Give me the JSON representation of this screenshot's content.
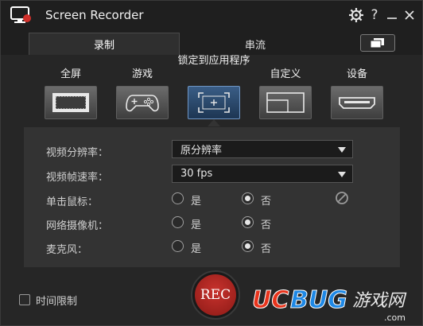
{
  "app": {
    "title": "Screen Recorder"
  },
  "tabs": [
    {
      "label": "录制"
    },
    {
      "label": "串流"
    }
  ],
  "modes": [
    {
      "label": "全屏",
      "icon": "fullscreen-icon"
    },
    {
      "label": "游戏",
      "icon": "gamepad-icon"
    },
    {
      "label": "锁定到应用程序",
      "icon": "lock-app-icon"
    },
    {
      "label": "自定义",
      "icon": "custom-area-icon"
    },
    {
      "label": "设备",
      "icon": "hdmi-device-icon"
    }
  ],
  "settings": {
    "resolution": {
      "label": "视频分辨率：",
      "value": "原分辨率"
    },
    "framerate": {
      "label": "视频帧速率：",
      "value": "30 fps"
    },
    "yes_label": "是",
    "no_label": "否",
    "mouse_click": {
      "label": "单击鼠标：",
      "selected": "否"
    },
    "webcam": {
      "label": "网络摄像机：",
      "selected": "否"
    },
    "microphone": {
      "label": "麦克风：",
      "selected": "否"
    }
  },
  "footer": {
    "time_limit_label": "时间限制",
    "time_limit_checked": false,
    "rec_label": "REC"
  },
  "watermark": {
    "brand": "UCBUG",
    "suffix": "游戏网",
    "domain": ".com"
  },
  "colors": {
    "accent_active": "#2d5a8e",
    "rec_red": "#b3241f",
    "panel": "#333333"
  }
}
